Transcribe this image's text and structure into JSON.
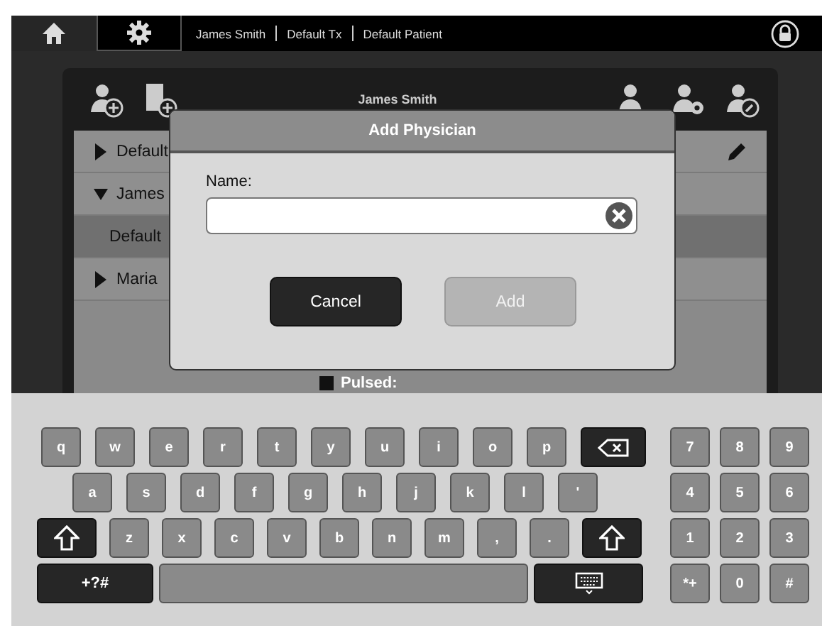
{
  "top_bar": {
    "tabs": [
      {
        "kind": "home",
        "selected": false
      },
      {
        "kind": "settings",
        "selected": true
      }
    ],
    "breadcrumb": [
      "James Smith",
      "Default Tx",
      "Default Patient"
    ]
  },
  "panel": {
    "title": "James Smith",
    "tree": [
      {
        "label": "Default",
        "expanded": false,
        "selected": false
      },
      {
        "label": "James",
        "expanded": true,
        "selected": false,
        "children": [
          {
            "label": "Default",
            "selected": true
          }
        ]
      },
      {
        "label": "Maria",
        "expanded": false,
        "selected": false
      }
    ],
    "mode_label": "Pulsed:"
  },
  "dialog": {
    "title": "Add Physician",
    "field_label": "Name:",
    "buttons": [
      {
        "label": "Cancel",
        "disabled": false
      },
      {
        "label": "Add",
        "disabled": true
      }
    ]
  },
  "keyboard": {
    "rows": [
      [
        {
          "kind": "char",
          "label": "q"
        },
        {
          "kind": "char",
          "label": "w"
        },
        {
          "kind": "char",
          "label": "e"
        },
        {
          "kind": "char",
          "label": "r"
        },
        {
          "kind": "char",
          "label": "t"
        },
        {
          "kind": "char",
          "label": "y"
        },
        {
          "kind": "char",
          "label": "u"
        },
        {
          "kind": "char",
          "label": "i"
        },
        {
          "kind": "char",
          "label": "o"
        },
        {
          "kind": "char",
          "label": "p"
        },
        {
          "kind": "backspace"
        }
      ],
      [
        {
          "kind": "char",
          "label": "a"
        },
        {
          "kind": "char",
          "label": "s"
        },
        {
          "kind": "char",
          "label": "d"
        },
        {
          "kind": "char",
          "label": "f"
        },
        {
          "kind": "char",
          "label": "g"
        },
        {
          "kind": "char",
          "label": "h"
        },
        {
          "kind": "char",
          "label": "j"
        },
        {
          "kind": "char",
          "label": "k"
        },
        {
          "kind": "char",
          "label": "l"
        },
        {
          "kind": "char",
          "label": "'"
        }
      ],
      [
        {
          "kind": "shift"
        },
        {
          "kind": "char",
          "label": "z"
        },
        {
          "kind": "char",
          "label": "x"
        },
        {
          "kind": "char",
          "label": "c"
        },
        {
          "kind": "char",
          "label": "v"
        },
        {
          "kind": "char",
          "label": "b"
        },
        {
          "kind": "char",
          "label": "n"
        },
        {
          "kind": "char",
          "label": "m"
        },
        {
          "kind": "char",
          "label": ","
        },
        {
          "kind": "char",
          "label": "."
        },
        {
          "kind": "shift"
        }
      ],
      [
        {
          "kind": "symbols",
          "label": "+?#"
        },
        {
          "kind": "space"
        },
        {
          "kind": "hide"
        }
      ]
    ],
    "numpad": [
      [
        "7",
        "8",
        "9"
      ],
      [
        "4",
        "5",
        "6"
      ],
      [
        "1",
        "2",
        "3"
      ],
      [
        "*+",
        "0",
        "#"
      ]
    ]
  }
}
